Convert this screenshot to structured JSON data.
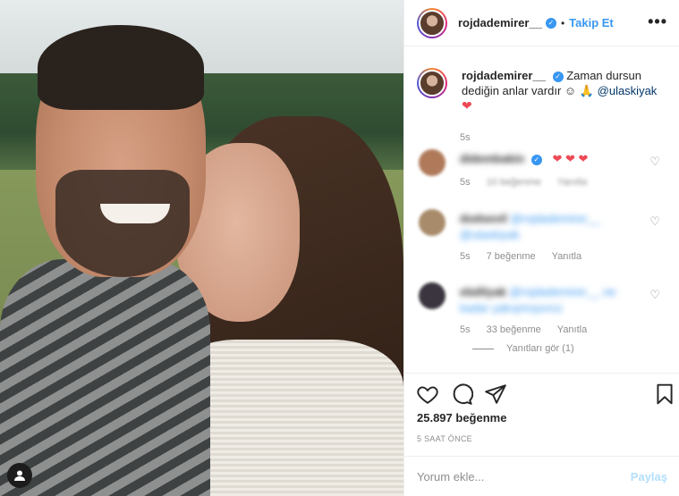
{
  "post": {
    "username": "rojdademirer__",
    "follow_label": "Takip Et",
    "more_label": "•••",
    "separator": "•",
    "caption_text_1": "Zaman dursun",
    "caption_text_2": "dediğin anlar vardır",
    "caption_mention": "@ulaskiyak",
    "caption_time": "5s",
    "likes": "25.897 beğenme",
    "time_ago": "5 SAAT ÖNCE",
    "comment_placeholder": "Yorum ekle...",
    "post_label": "Paylaş"
  },
  "comments": [
    {
      "user": "didembakin",
      "text": "",
      "time": "5s",
      "likes": "10 beğenme",
      "reply": "Yanıtla"
    },
    {
      "user": "dodsevil",
      "text": "@rojdademirer__ @ulaskiyak",
      "time": "5s",
      "likes": "7 beğenme",
      "reply": "Yanıtla"
    },
    {
      "user": "ebdilyak",
      "text": "@rojdademirer__ ne kadar yakışmışsınız",
      "time": "5s",
      "likes": "33 beğenme",
      "reply": "Yanıtla",
      "view_replies": "Yanıtları gör (1)"
    }
  ],
  "colors": {
    "accent": "#3897f0",
    "heart": "#ed4956",
    "muted": "#8e8e8e"
  },
  "icons": [
    "verified-icon",
    "more-icon",
    "heart-icon",
    "comment-icon",
    "share-icon",
    "bookmark-icon",
    "user-tag-icon"
  ]
}
